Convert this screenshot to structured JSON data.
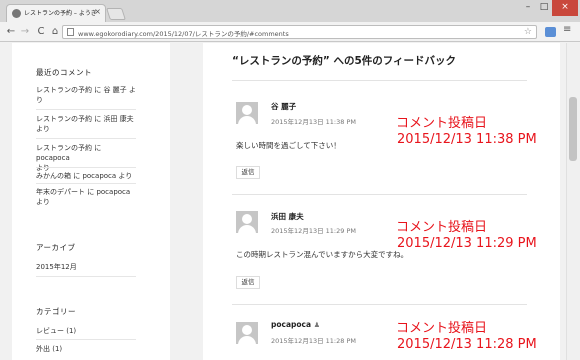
{
  "browser": {
    "tab_title": "レストランの予約 – ようぎ日記",
    "tab_close": "×",
    "url": "www.egokorodiary.com/2015/12/07/レストランの予約/#comments",
    "window_controls": {
      "minimize": "–",
      "maximize": "□",
      "close": "×"
    },
    "nav": {
      "back": "←",
      "forward": "→",
      "reload": "C",
      "home": "⌂",
      "star": "☆",
      "menu": "≡"
    }
  },
  "sidebar": {
    "recent_comments": {
      "title": "最近のコメント",
      "items": [
        {
          "line1": "レストランの予約 に 谷 麗子 よ",
          "line2": "り"
        },
        {
          "line1": "レストランの予約 に 浜田 康夫",
          "line2": "より"
        },
        {
          "line1": "レストランの予約 に pocapoca",
          "line2": "より"
        },
        {
          "line1": "みかんの箱 に pocapoca より",
          "line2": ""
        },
        {
          "line1": "年末のデパート に pocapoca",
          "line2": "より"
        }
      ]
    },
    "archives": {
      "title": "アーカイブ",
      "items": [
        "2015年12月"
      ]
    },
    "categories": {
      "title": "カテゴリー",
      "items": [
        "レビュー (1)",
        "外出 (1)"
      ]
    }
  },
  "main": {
    "title": "“レストランの予約” への5件のフィードバック",
    "reply_label": "返信",
    "comments": [
      {
        "author": "谷 麗子",
        "badge": "",
        "date": "2015年12月13日 11:38 PM",
        "body": "楽しい時間を過ごして下さい！"
      },
      {
        "author": "浜田 康夫",
        "badge": "",
        "date": "2015年12月13日 11:29 PM",
        "body": "この時期レストラン混んでいますから大変ですね。"
      },
      {
        "author": "pocapoca",
        "badge": "♟",
        "date": "2015年12月13日 11:28 PM",
        "body": ""
      }
    ]
  },
  "annotations": [
    {
      "label": "コメント投稿日",
      "date": "2015/12/13 11:38 PM"
    },
    {
      "label": "コメント投稿日",
      "date": "2015/12/13 11:29 PM"
    },
    {
      "label": "コメント投稿日",
      "date": "2015/12/13 11:28 PM"
    }
  ],
  "colors": {
    "annotation": "#e8141c",
    "close_button": "#c9483c"
  }
}
